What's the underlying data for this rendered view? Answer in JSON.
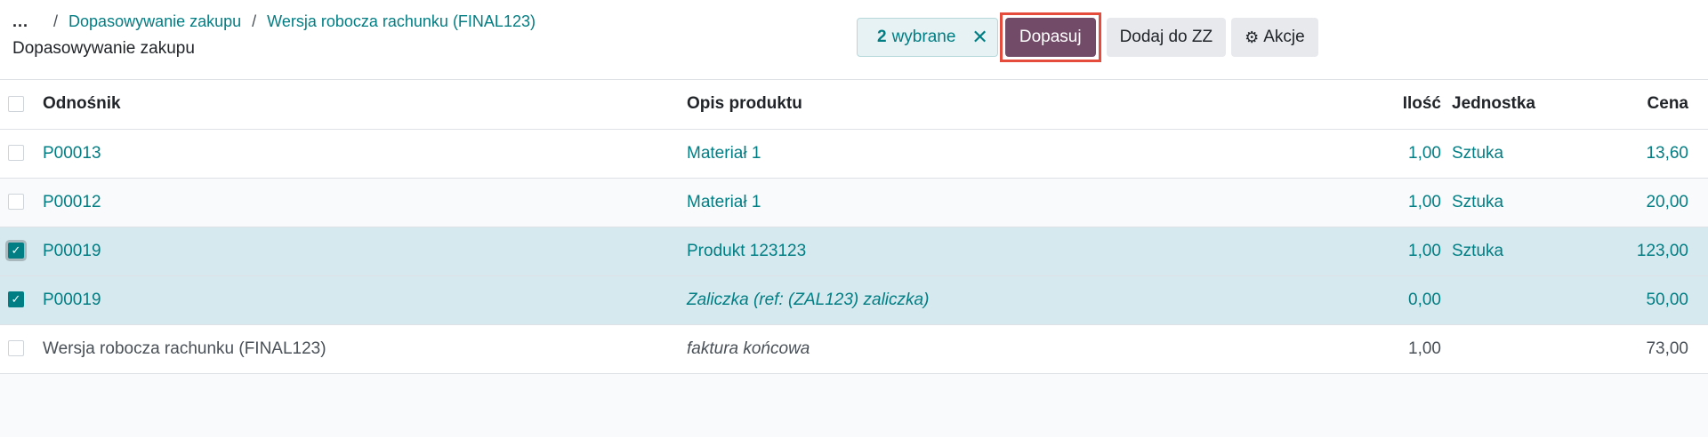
{
  "breadcrumb": {
    "dots": "...",
    "separator": "/",
    "items": [
      "Dopasowywanie zakupu",
      "Wersja robocza rachunku (FINAL123)"
    ]
  },
  "page_title": "Dopasowywanie zakupu",
  "selection": {
    "count": "2",
    "label": "wybrane",
    "clear_icon": "close-icon"
  },
  "buttons": {
    "match": "Dopasuj",
    "add_zz": "Dodaj do ZZ",
    "actions": "Akcje",
    "actions_icon": "gear-icon"
  },
  "highlight_color": "#e64c3c",
  "accent_color": "#017e84",
  "primary_color": "#714b67",
  "table": {
    "columns": [
      "Odnośnik",
      "Opis produktu",
      "Ilość",
      "Jednostka",
      "Cena"
    ],
    "rows": [
      {
        "ref": "P00013",
        "desc": "Materiał 1",
        "qty": "1,00",
        "unit": "Sztuka",
        "price": "13,60",
        "checked": false
      },
      {
        "ref": "P00012",
        "desc": "Materiał 1",
        "qty": "1,00",
        "unit": "Sztuka",
        "price": "20,00",
        "checked": false
      },
      {
        "ref": "P00019",
        "desc": "Produkt 123123",
        "qty": "1,00",
        "unit": "Sztuka",
        "price": "123,00",
        "checked": true
      },
      {
        "ref": "P00019",
        "desc": "Zaliczka (ref: (ZAL123) zaliczka)",
        "qty": "0,00",
        "unit": "",
        "price": "50,00",
        "checked": true
      },
      {
        "ref": "Wersja robocza rachunku (FINAL123)",
        "desc": "faktura końcowa",
        "qty": "1,00",
        "unit": "",
        "price": "73,00",
        "checked": false
      }
    ]
  }
}
